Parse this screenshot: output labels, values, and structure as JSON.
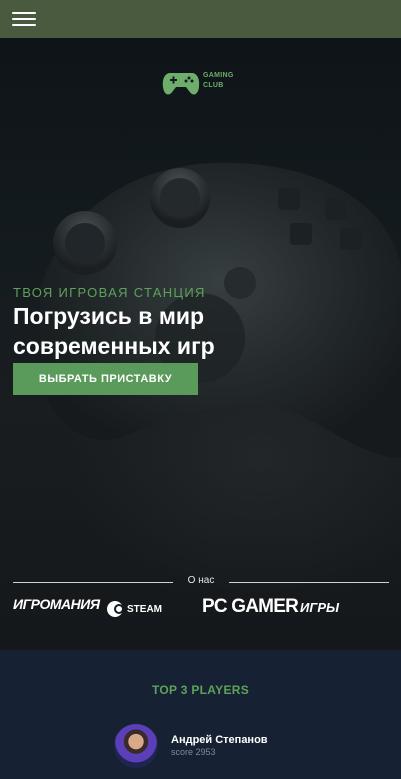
{
  "topbar": {
    "menu_icon": "hamburger-menu-icon"
  },
  "hero": {
    "logo": {
      "icon": "gamepad-icon",
      "line1": "GAMING",
      "line2": "CLUB"
    },
    "tagline": "ТВОЯ ИГРОВАЯ СТАНЦИЯ",
    "headline": "Погрузись в мир современных игр",
    "cta_label": "ВЫБРАТЬ ПРИСТАВКУ",
    "about_label": "О нас",
    "partners": [
      "ИГРОМАНИЯ",
      "STEAM",
      "PC GAMER",
      "ИГРЫ"
    ]
  },
  "players": {
    "title": "TOP 3 PLAYERS",
    "list": [
      {
        "name": "Андрей Степанов",
        "score": "score 2953"
      }
    ]
  },
  "colors": {
    "accent": "#5a9a5a",
    "topbar": "#4a5a3f",
    "footer_bg": "#162233"
  }
}
